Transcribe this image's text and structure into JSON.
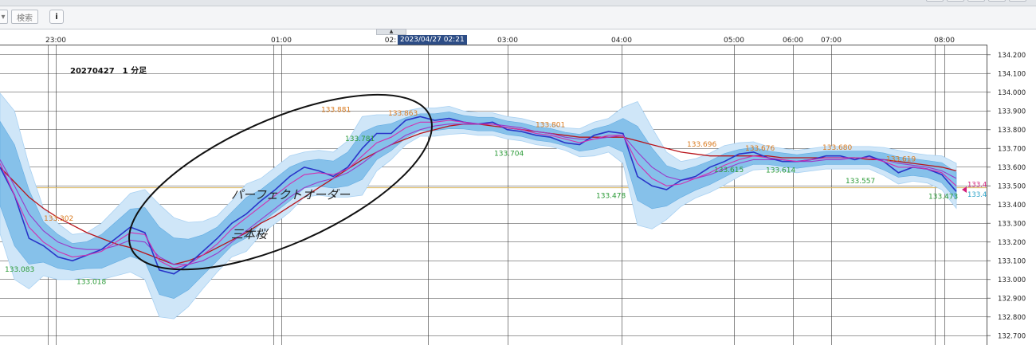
{
  "toolbar": {
    "search_label": "検索",
    "info_label": "i"
  },
  "tooltip_date": "2023/04/27 02:21",
  "chart_data": {
    "type": "line",
    "title": "20270427　1 分足",
    "y_range": [
      132.65,
      134.25
    ],
    "y_ticks": [
      "134.200",
      "134.100",
      "134.000",
      "133.900",
      "133.800",
      "133.700",
      "133.600",
      "133.500",
      "133.400",
      "133.300",
      "133.200",
      "133.100",
      "133.000",
      "132.900",
      "132.800",
      "132.700"
    ],
    "x_ticks": [
      "23:00",
      "01:00",
      "02:",
      "03:00",
      "04:00",
      "05:00",
      "06:00",
      "07:00",
      "08:00"
    ],
    "reference_line": 133.49,
    "price_label_top": "133.4",
    "price_label_bottom": "133.4",
    "annotations": {
      "circle_text_line1": "パーフェクトオーダー",
      "circle_text_line2": "三本桜"
    },
    "high_labels": [
      {
        "label": "133.302",
        "value": 133.302
      },
      {
        "label": "133.881",
        "value": 133.881
      },
      {
        "label": "133.863",
        "value": 133.863
      },
      {
        "label": "133.801",
        "value": 133.801
      },
      {
        "label": "133.696",
        "value": 133.696
      },
      {
        "label": "133.676",
        "value": 133.676
      },
      {
        "label": "133.680",
        "value": 133.68
      },
      {
        "label": "133.619",
        "value": 133.619
      }
    ],
    "low_labels": [
      {
        "label": "133.083",
        "value": 133.083
      },
      {
        "label": "133.018",
        "value": 133.018
      },
      {
        "label": "133.781",
        "value": 133.781
      },
      {
        "label": "133.704",
        "value": 133.704
      },
      {
        "label": "133.478",
        "value": 133.478
      },
      {
        "label": "133.615",
        "value": 133.615
      },
      {
        "label": "133.614",
        "value": 133.614
      },
      {
        "label": "133.557",
        "value": 133.557
      },
      {
        "label": "133.473",
        "value": 133.473
      }
    ],
    "price_series": [
      133.6,
      133.45,
      133.22,
      133.18,
      133.12,
      133.1,
      133.13,
      133.16,
      133.22,
      133.28,
      133.25,
      133.05,
      133.03,
      133.08,
      133.15,
      133.22,
      133.3,
      133.35,
      133.42,
      133.48,
      133.55,
      133.6,
      133.58,
      133.55,
      133.6,
      133.7,
      133.78,
      133.78,
      133.85,
      133.87,
      133.85,
      133.86,
      133.84,
      133.83,
      133.84,
      133.8,
      133.79,
      133.77,
      133.76,
      133.73,
      133.72,
      133.77,
      133.79,
      133.78,
      133.55,
      133.5,
      133.48,
      133.53,
      133.55,
      133.6,
      133.63,
      133.67,
      133.68,
      133.65,
      133.63,
      133.63,
      133.64,
      133.66,
      133.66,
      133.64,
      133.66,
      133.63,
      133.57,
      133.6,
      133.59,
      133.56,
      133.47
    ],
    "ma_short": [
      133.62,
      133.45,
      133.28,
      133.2,
      133.15,
      133.12,
      133.13,
      133.15,
      133.2,
      133.25,
      133.24,
      133.1,
      133.06,
      133.08,
      133.13,
      133.19,
      133.27,
      133.33,
      133.39,
      133.45,
      133.51,
      133.56,
      133.57,
      133.56,
      133.59,
      133.66,
      133.73,
      133.76,
      133.81,
      133.84,
      133.84,
      133.85,
      133.84,
      133.83,
      133.83,
      133.81,
      133.8,
      133.78,
      133.77,
      133.75,
      133.73,
      133.75,
      133.77,
      133.77,
      133.62,
      133.54,
      133.5,
      133.51,
      133.54,
      133.57,
      133.61,
      133.64,
      133.66,
      133.65,
      133.64,
      133.63,
      133.64,
      133.65,
      133.65,
      133.65,
      133.65,
      133.63,
      133.6,
      133.6,
      133.59,
      133.57,
      133.5
    ],
    "ma_mid": [
      133.64,
      133.5,
      133.35,
      133.26,
      133.2,
      133.17,
      133.16,
      133.16,
      133.18,
      133.21,
      133.2,
      133.12,
      133.08,
      133.08,
      133.1,
      133.14,
      133.2,
      133.26,
      133.32,
      133.38,
      133.44,
      133.49,
      133.52,
      133.54,
      133.57,
      133.62,
      133.68,
      133.72,
      133.77,
      133.8,
      133.82,
      133.83,
      133.83,
      133.83,
      133.83,
      133.82,
      133.81,
      133.79,
      133.78,
      133.76,
      133.75,
      133.75,
      133.76,
      133.77,
      133.68,
      133.6,
      133.55,
      133.53,
      133.54,
      133.56,
      133.59,
      133.62,
      133.64,
      133.64,
      133.64,
      133.63,
      133.63,
      133.64,
      133.64,
      133.65,
      133.65,
      133.64,
      133.62,
      133.61,
      133.6,
      133.58,
      133.54
    ],
    "ma_long": [
      133.6,
      133.52,
      133.44,
      133.38,
      133.33,
      133.29,
      133.25,
      133.22,
      133.19,
      133.17,
      133.14,
      133.11,
      133.08,
      133.1,
      133.13,
      133.17,
      133.21,
      133.25,
      133.3,
      133.34,
      133.39,
      133.44,
      133.49,
      133.54,
      133.59,
      133.64,
      133.68,
      133.72,
      133.75,
      133.78,
      133.8,
      133.82,
      133.83,
      133.83,
      133.82,
      133.81,
      133.8,
      133.79,
      133.78,
      133.77,
      133.76,
      133.76,
      133.76,
      133.76,
      133.74,
      133.72,
      133.7,
      133.68,
      133.67,
      133.66,
      133.66,
      133.66,
      133.66,
      133.66,
      133.65,
      133.65,
      133.65,
      133.65,
      133.65,
      133.65,
      133.64,
      133.64,
      133.63,
      133.62,
      133.61,
      133.6,
      133.58
    ],
    "band_width": [
      0.25,
      0.3,
      0.22,
      0.12,
      0.1,
      0.08,
      0.08,
      0.1,
      0.12,
      0.14,
      0.16,
      0.2,
      0.18,
      0.15,
      0.12,
      0.1,
      0.1,
      0.12,
      0.1,
      0.1,
      0.1,
      0.08,
      0.08,
      0.08,
      0.1,
      0.14,
      0.1,
      0.08,
      0.06,
      0.05,
      0.05,
      0.05,
      0.04,
      0.04,
      0.04,
      0.04,
      0.04,
      0.04,
      0.04,
      0.04,
      0.05,
      0.06,
      0.06,
      0.1,
      0.22,
      0.18,
      0.12,
      0.08,
      0.07,
      0.07,
      0.07,
      0.06,
      0.05,
      0.04,
      0.04,
      0.04,
      0.04,
      0.04,
      0.04,
      0.04,
      0.04,
      0.05,
      0.06,
      0.05,
      0.05,
      0.06,
      0.08
    ],
    "colors": {
      "price": "#2a35c8",
      "ma_short": "#d22fb0",
      "ma_mid": "#9a3bc9",
      "ma_long": "#b8141b",
      "band_outer": "#cfe6f8",
      "band_inner": "#7fbde9",
      "grid": "#3a3a3a",
      "reference_line": "#d9b45b",
      "high_label": "#d97a1f",
      "low_label": "#2a9a36",
      "tooltip_bg": "#2d4d86"
    }
  }
}
